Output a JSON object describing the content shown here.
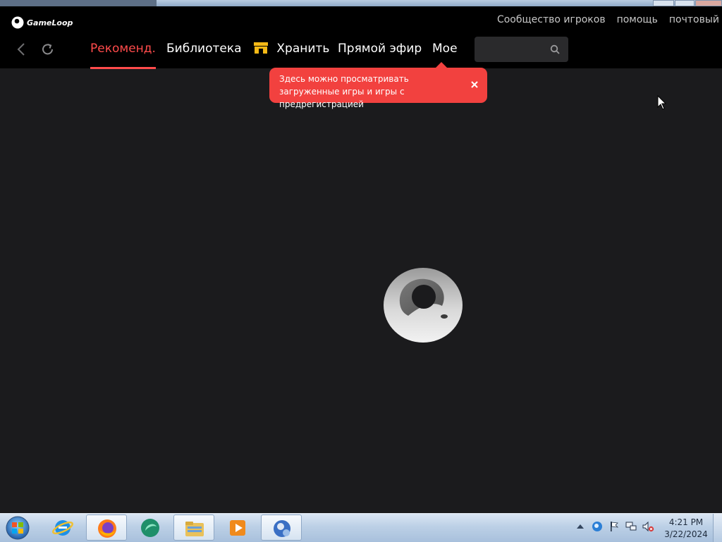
{
  "app": {
    "logo_text": "GameLoop"
  },
  "top_links": [
    {
      "label": "Сообщество игроков"
    },
    {
      "label": "помощь"
    },
    {
      "label": "почтовый"
    }
  ],
  "tabs": [
    {
      "label": "Рекоменд.",
      "active": true
    },
    {
      "label": "Библиотека",
      "active": false
    },
    {
      "label": "Хранить",
      "active": false,
      "icon": "store-icon"
    },
    {
      "label": "Прямой эфир",
      "active": false
    },
    {
      "label": "Мое",
      "active": false
    }
  ],
  "search": {
    "value": "",
    "placeholder": ""
  },
  "tooltip": {
    "text": "Здесь можно просматривать загруженные игры и игры с предрегистрацией"
  },
  "taskbar": {
    "items": [
      {
        "icon": "internet-explorer-icon",
        "state": "pinned"
      },
      {
        "icon": "firefox-icon",
        "state": "running"
      },
      {
        "icon": "app-icon",
        "state": "pinned"
      },
      {
        "icon": "file-explorer-icon",
        "state": "running"
      },
      {
        "icon": "media-player-icon",
        "state": "pinned"
      },
      {
        "icon": "gameloop-icon",
        "state": "running"
      }
    ],
    "clock": {
      "time": "4:21 PM",
      "date": "3/22/2024"
    }
  },
  "colors": {
    "accent": "#ff4b4b",
    "tooltip": "#f2413f",
    "background": "#1b1b1d",
    "header": "#000000"
  }
}
